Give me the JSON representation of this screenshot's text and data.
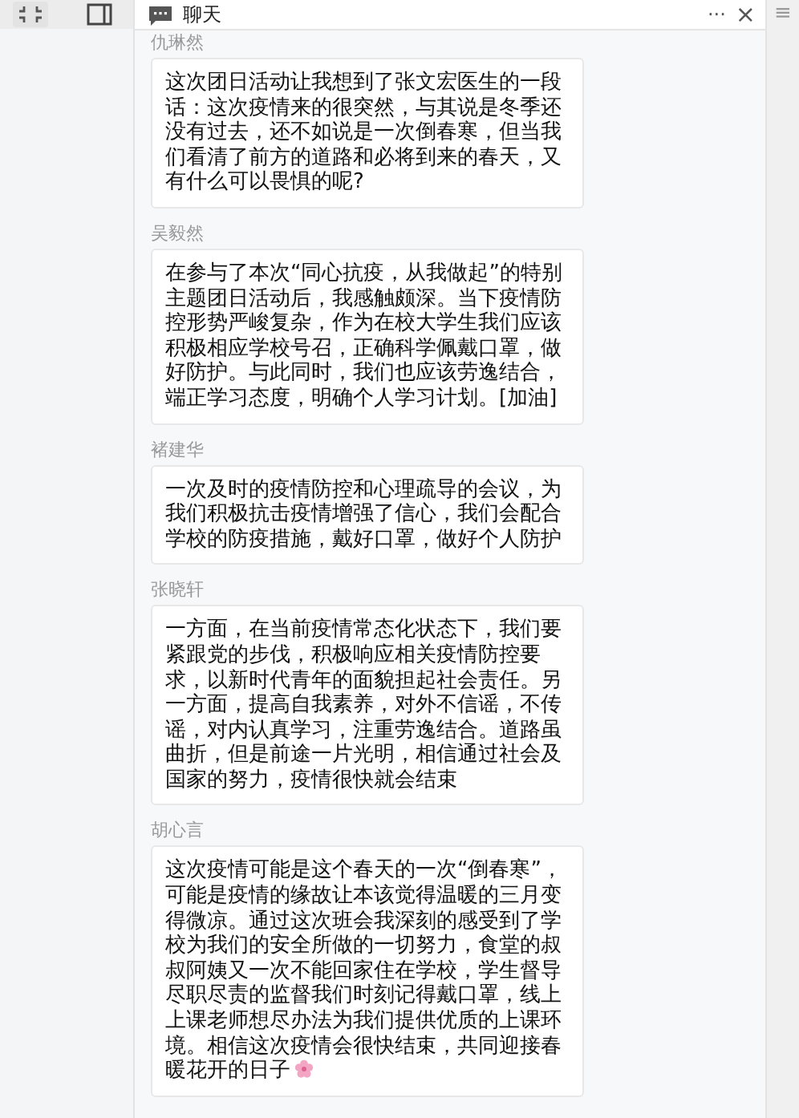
{
  "header": {
    "title": "聊天",
    "more": "···",
    "close": "×",
    "menu": "≡"
  },
  "messages": [
    {
      "sender": "仇琳然",
      "text": "这次团日活动让我想到了张文宏医生的一段话：这次疫情来的很突然，与其说是冬季还没有过去，还不如说是一次倒春寒，但当我们看清了前方的道路和必将到来的春天，又有什么可以畏惧的呢?",
      "emoji": false
    },
    {
      "sender": "吴毅然",
      "text": "在参与了本次“同心抗疫，从我做起”的特别主题团日活动后，我感触颇深。当下疫情防控形势严峻复杂，作为在校大学生我们应该积极相应学校号召，正确科学佩戴口罩，做好防护。与此同时，我们也应该劳逸结合，端正学习态度，明确个人学习计划。[加油]",
      "emoji": false
    },
    {
      "sender": "褚建华",
      "text": "一次及时的疫情防控和心理疏导的会议，为我们积极抗击疫情增强了信心，我们会配合学校的防疫措施，戴好口罩，做好个人防护",
      "emoji": false
    },
    {
      "sender": "张晓轩",
      "text": "一方面，在当前疫情常态化状态下，我们要紧跟党的步伐，积极响应相关疫情防控要求，以新时代青年的面貌担起社会责任。另一方面，提高自我素养，对外不信谣，不传谣，对内认真学习，注重劳逸结合。道路虽曲折，但是前途一片光明，相信通过社会及国家的努力，疫情很快就会结束",
      "emoji": false
    },
    {
      "sender": "胡心言",
      "text": "这次疫情可能是这个春天的一次“倒春寒”，可能是疫情的缘故让本该觉得温暖的三月变得微凉。通过这次班会我深刻的感受到了学校为我们的安全所做的一切努力，食堂的叔叔阿姨又一次不能回家住在学校，学生督导尽职尽责的监督我们时刻记得戴口罩，线上上课老师想尽办法为我们提供优质的上课环境。相信这次疫情会很快结束，共同迎接春暖花开的日子",
      "emoji": true
    }
  ]
}
